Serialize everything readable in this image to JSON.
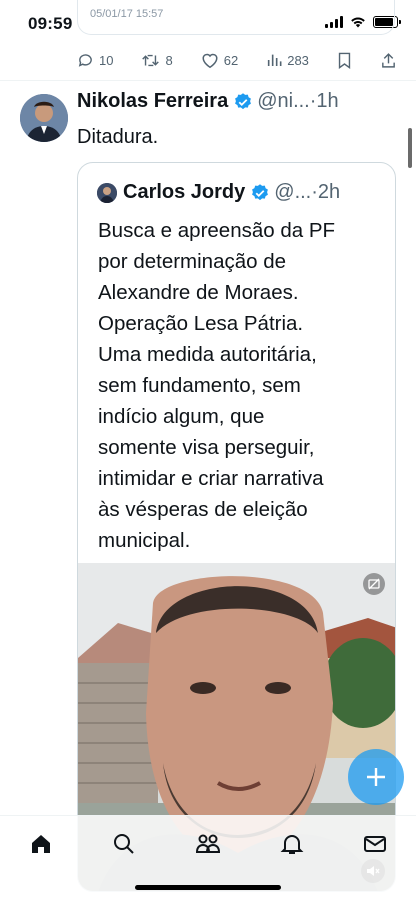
{
  "status_bar": {
    "time": "09:59"
  },
  "previous_tweet": {
    "date": "05/01/17 15:57",
    "replies": "10",
    "retweets": "8",
    "likes": "62",
    "views": "283"
  },
  "tweet": {
    "author_name": "Nikolas Ferreira",
    "author_handle": "@ni...",
    "time": "1h",
    "text": "Ditadura."
  },
  "quoted_tweet": {
    "author_name": "Carlos Jordy",
    "author_handle": "@...",
    "time": "2h",
    "lines": [
      "Busca e apreensão da PF",
      "por determinação de",
      "Alexandre de Moraes.",
      "Operação Lesa Pátria.",
      "Uma medida autoritária,",
      "sem fundamento, sem",
      "indício algum, que",
      "somente visa perseguir,",
      "intimidar e criar narrativa",
      "às vésperas de eleição",
      "municipal."
    ]
  },
  "colors": {
    "verified": "#1d9bf0",
    "fab": "#1d9bf0",
    "secondary_text": "#536471",
    "border": "#cfd9de"
  },
  "icons": {
    "reply": "reply-icon",
    "retweet": "retweet-icon",
    "like": "heart-icon",
    "views": "views-icon",
    "bookmark": "bookmark-icon",
    "share": "share-icon",
    "verified": "verified-badge-icon",
    "nav": [
      "home-icon",
      "search-icon",
      "communities-icon",
      "notifications-icon",
      "messages-icon"
    ],
    "compose": "plus-icon",
    "mute": "mute-icon"
  }
}
